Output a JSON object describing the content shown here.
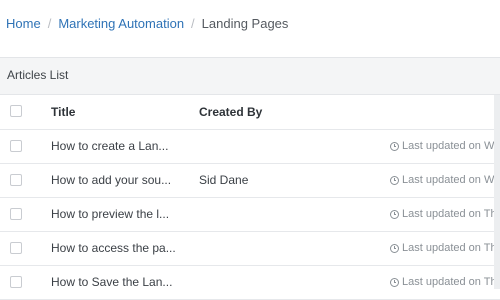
{
  "breadcrumb": {
    "items": [
      {
        "label": "Home"
      },
      {
        "label": "Marketing Automation"
      }
    ],
    "separator": "/",
    "current": "Landing Pages"
  },
  "panel": {
    "title": "Articles List"
  },
  "table": {
    "columns": {
      "title": "Title",
      "created_by": "Created By"
    },
    "rows": [
      {
        "title": "How to create a Lan...",
        "created_by": "",
        "updated": "Last updated on We"
      },
      {
        "title": "How to add your sou...",
        "created_by": "Sid Dane",
        "updated": "Last updated on We"
      },
      {
        "title": "How to preview the l...",
        "created_by": "",
        "updated": "Last updated on Thu"
      },
      {
        "title": "How to access the pa...",
        "created_by": "",
        "updated": "Last updated on Thu"
      },
      {
        "title": "How to Save the Lan...",
        "created_by": "",
        "updated": "Last updated on Thu"
      }
    ]
  },
  "icons": {
    "updated": "clock-icon"
  },
  "colors": {
    "link": "#2f73b6",
    "panel_bg": "#f4f5f6",
    "muted_text": "#8a9096"
  }
}
